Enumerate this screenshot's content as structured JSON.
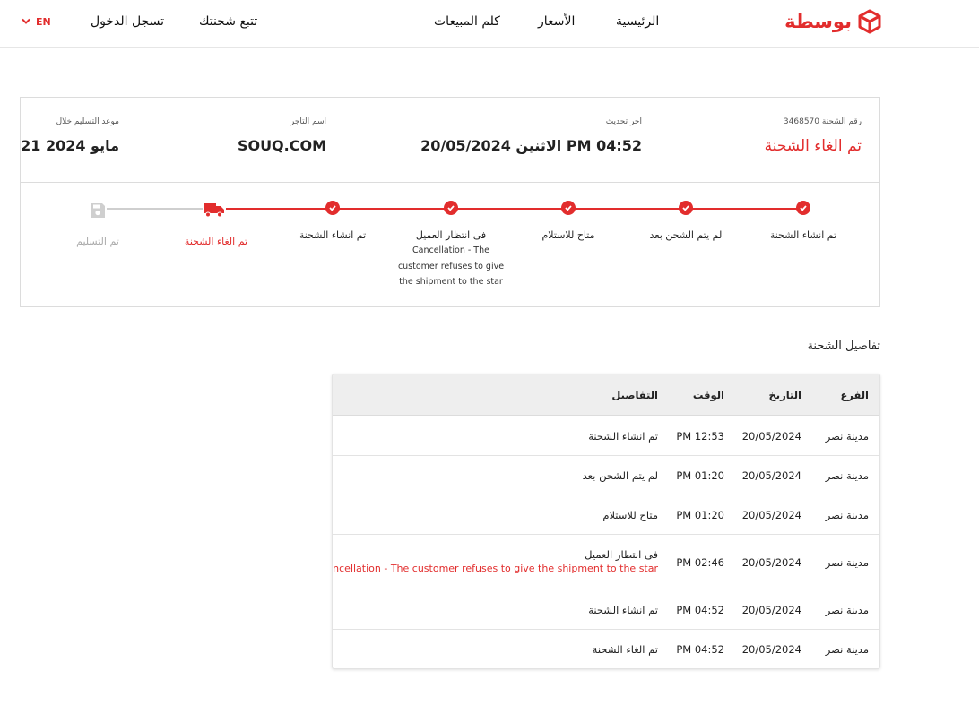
{
  "header": {
    "lang": "EN",
    "login": "تسجل الدخول",
    "track": "تتبع شحنتك",
    "sales": "كلم المبيعات",
    "prices": "الأسعار",
    "home": "الرئيسية",
    "logo_text": "بوسطة"
  },
  "shipment": {
    "number_label": "رقم الشحنة 3468570",
    "status": "تم الغاء الشحنة",
    "last_update_label": "اخر تحديث",
    "last_update_value": "الاثنين 20/05/2024 PM 04:52",
    "merchant_label": "اسم التاجر",
    "merchant_value": "SOUQ.COM",
    "delivery_label": "موعد التسليم خلال",
    "delivery_value": "21 مايو 2024"
  },
  "timeline": [
    {
      "label": "تم انشاء الشحنة"
    },
    {
      "label": "لم يتم الشحن بعد"
    },
    {
      "label": "متاح للاستلام"
    },
    {
      "label": "فى انتظار العميل",
      "sub1": "Cancellation - The",
      "sub2": "customer refuses to give",
      "sub3": "the shipment to the star"
    },
    {
      "label": "تم انشاء الشحنة"
    },
    {
      "label": "تم الغاء الشحنة"
    },
    {
      "label": "تم التسليم"
    }
  ],
  "details": {
    "title": "تفاصيل الشحنة",
    "columns": {
      "branch": "الفرع",
      "date": "التاريخ",
      "time": "الوقت",
      "details": "التفاصيل"
    },
    "rows": [
      {
        "branch": "مدينة نصر",
        "date": "20/05/2024",
        "time": "PM 12:53",
        "details": "تم انشاء الشحنة"
      },
      {
        "branch": "مدينة نصر",
        "date": "20/05/2024",
        "time": "PM 01:20",
        "details": "لم يتم الشحن بعد"
      },
      {
        "branch": "مدينة نصر",
        "date": "20/05/2024",
        "time": "PM 01:20",
        "details": "متاح للاستلام"
      },
      {
        "branch": "مدينة نصر",
        "date": "20/05/2024",
        "time": "PM 02:46",
        "details": "فى انتظار العميل",
        "sub": "Cancellation - The customer refuses to give the shipment to the star"
      },
      {
        "branch": "مدينة نصر",
        "date": "20/05/2024",
        "time": "PM 04:52",
        "details": "تم انشاء الشحنة"
      },
      {
        "branch": "مدينة نصر",
        "date": "20/05/2024",
        "time": "PM 04:52",
        "details": "تم الغاء الشحنة"
      }
    ]
  },
  "colors": {
    "brand": "#e22d2d",
    "inactive": "#cfcfcf"
  }
}
